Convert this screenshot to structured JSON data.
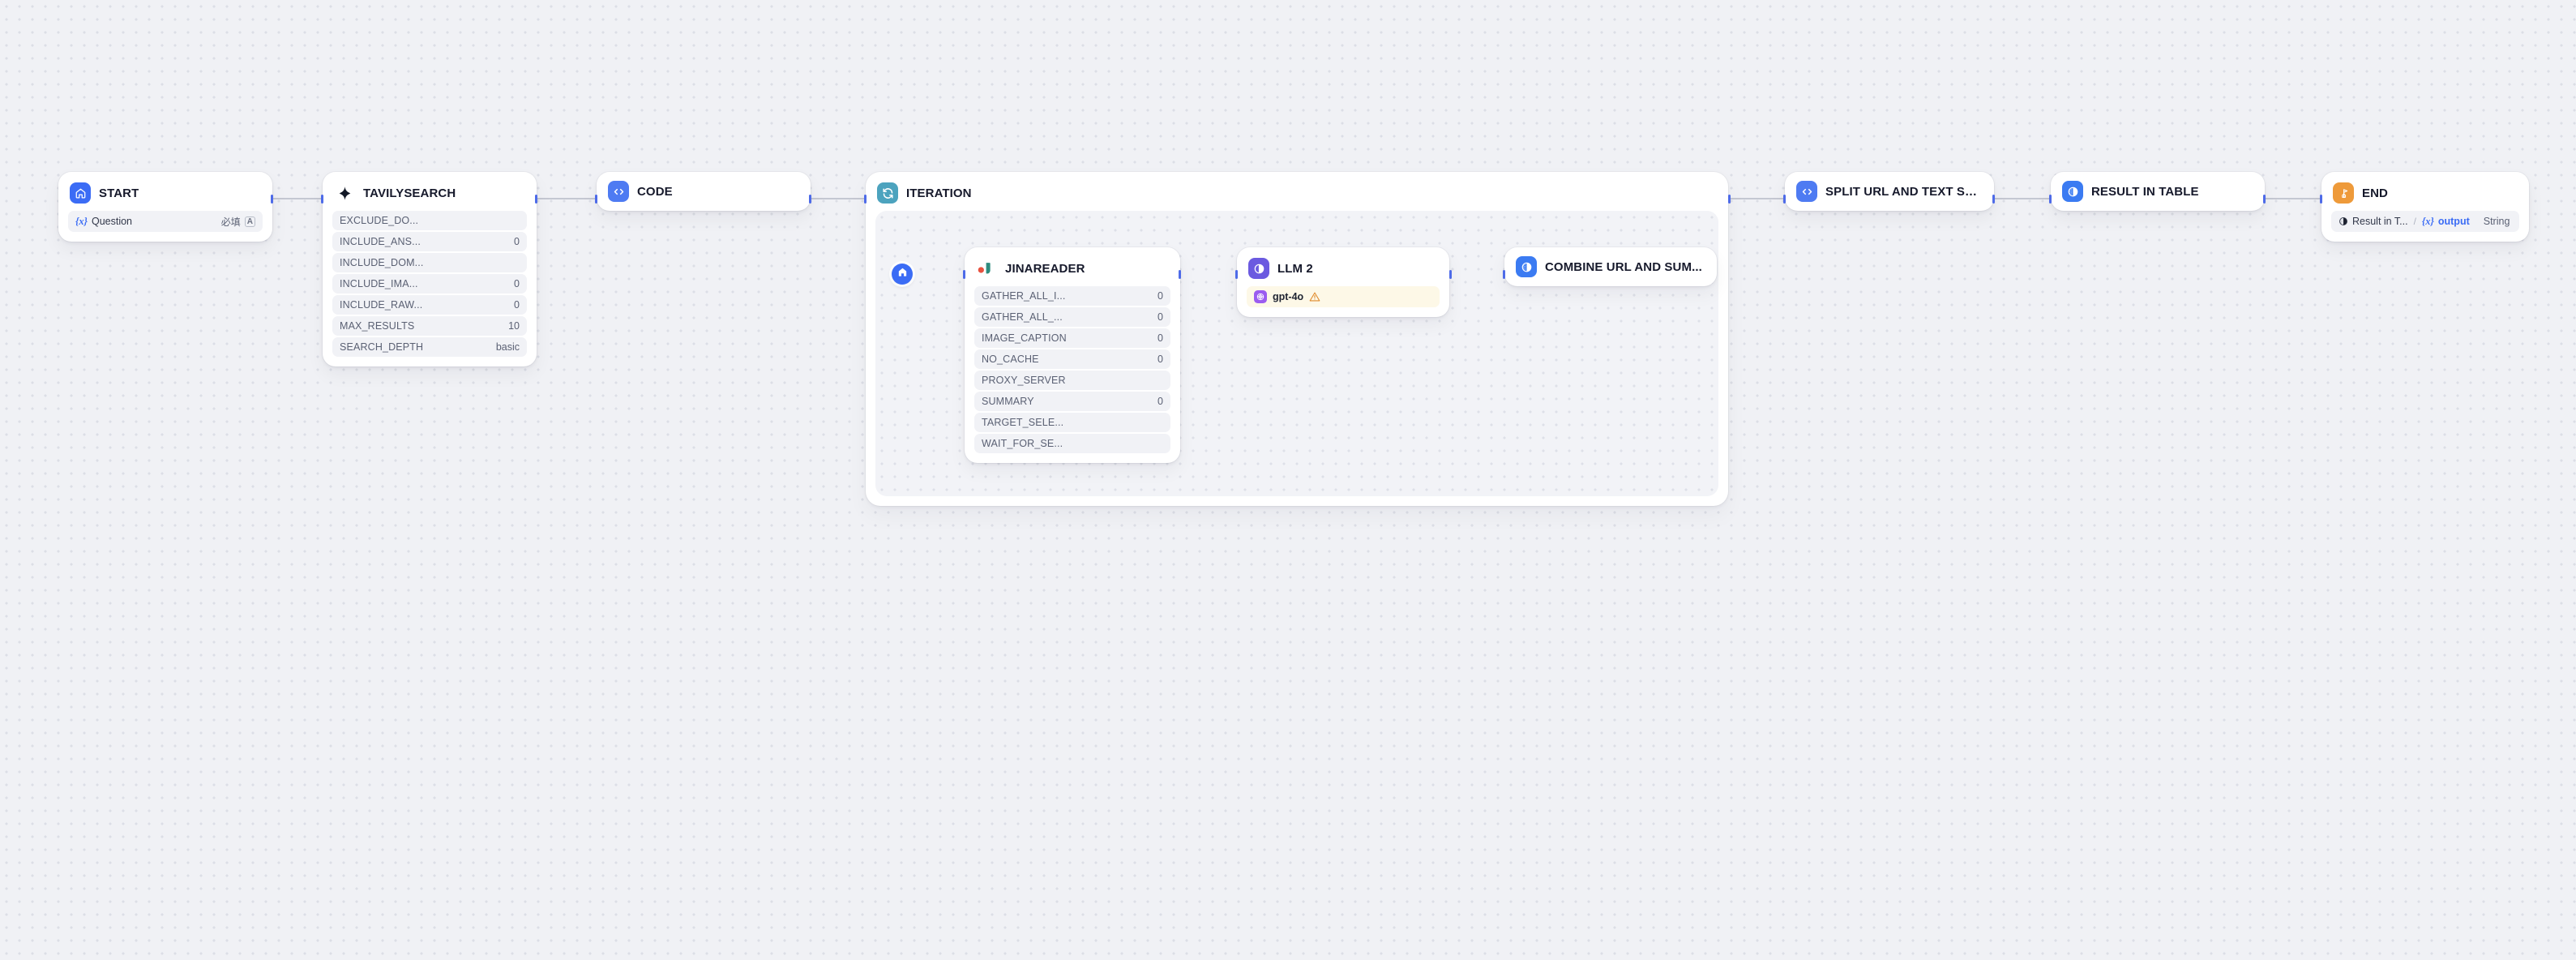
{
  "canvas": {
    "background_color": "#F0F1F5",
    "dot_color": "#DCDEE6"
  },
  "colors": {
    "accent_blue": "#3B6CF5",
    "edge": "#B6BAC6",
    "handle": "#4E6BE8",
    "iteration_teal": "#4CA3BE",
    "end_orange": "#EE9A3A",
    "llm_purple": "#6B5AE0",
    "jina_teal": "#2E8B7E",
    "jina_red": "#E8513F",
    "warning_orange": "#E08A2B",
    "model_badge_bg": "#FDF8E7",
    "param_row_bg": "#F1F2F6"
  },
  "nodes": [
    {
      "id": "start",
      "title": "START",
      "icon": "home-icon",
      "icon_bg": "#3B6CF5",
      "variables": [
        {
          "prefix": "{x}",
          "name": "Question",
          "required_label": "必填",
          "type_label": "A"
        }
      ]
    },
    {
      "id": "tavilysearch",
      "title": "TAVILYSEARCH",
      "icon": "sparkle-star-icon",
      "icon_bg": "transparent",
      "params": [
        {
          "key": "EXCLUDE_DO...",
          "value": ""
        },
        {
          "key": "INCLUDE_ANS...",
          "value": "0"
        },
        {
          "key": "INCLUDE_DOM...",
          "value": ""
        },
        {
          "key": "INCLUDE_IMA...",
          "value": "0"
        },
        {
          "key": "INCLUDE_RAW...",
          "value": "0"
        },
        {
          "key": "MAX_RESULTS",
          "value": "10"
        },
        {
          "key": "SEARCH_DEPTH",
          "value": "basic"
        }
      ]
    },
    {
      "id": "code",
      "title": "CODE",
      "icon": "code-brackets-icon",
      "icon_bg": "#4E7BF2"
    },
    {
      "id": "iteration",
      "title": "ITERATION",
      "icon": "loop-refresh-icon",
      "icon_bg": "#4CA3BE"
    },
    {
      "id": "jinareader",
      "title": "JINAREADER",
      "icon": "jina-logo-icon",
      "icon_bg": "transparent",
      "params": [
        {
          "key": "GATHER_ALL_I...",
          "value": "0"
        },
        {
          "key": "GATHER_ALL_...",
          "value": "0"
        },
        {
          "key": "IMAGE_CAPTION",
          "value": "0"
        },
        {
          "key": "NO_CACHE",
          "value": "0"
        },
        {
          "key": "PROXY_SERVER",
          "value": ""
        },
        {
          "key": "SUMMARY",
          "value": "0"
        },
        {
          "key": "TARGET_SELE...",
          "value": ""
        },
        {
          "key": "WAIT_FOR_SE...",
          "value": ""
        }
      ]
    },
    {
      "id": "llm2",
      "title": "LLM 2",
      "icon": "llm-circle-icon",
      "icon_bg": "#6B5AE0",
      "model": {
        "name": "gpt-4o",
        "provider_icon": "openai-icon",
        "status_icon": "warning-triangle-icon"
      }
    },
    {
      "id": "combine",
      "title": "COMBINE URL AND SUM...",
      "icon": "template-transform-icon",
      "icon_bg": "#3B7BF2"
    },
    {
      "id": "split",
      "title": "SPLIT URL AND TEXT SU...",
      "icon": "code-brackets-icon",
      "icon_bg": "#4E7BF2"
    },
    {
      "id": "result_table",
      "title": "RESULT IN TABLE",
      "icon": "template-transform-icon",
      "icon_bg": "#3B7BF2"
    },
    {
      "id": "end",
      "title": "END",
      "icon": "finish-flag-icon",
      "icon_bg": "#EE9A3A",
      "output": {
        "source_icon": "half-circle-icon",
        "source": "Result in T...",
        "separator": "/",
        "prefix": "{x}",
        "name": "output",
        "type": "String"
      }
    }
  ],
  "iteration_start": {
    "icon": "home-icon",
    "label": "iteration-start-node"
  }
}
